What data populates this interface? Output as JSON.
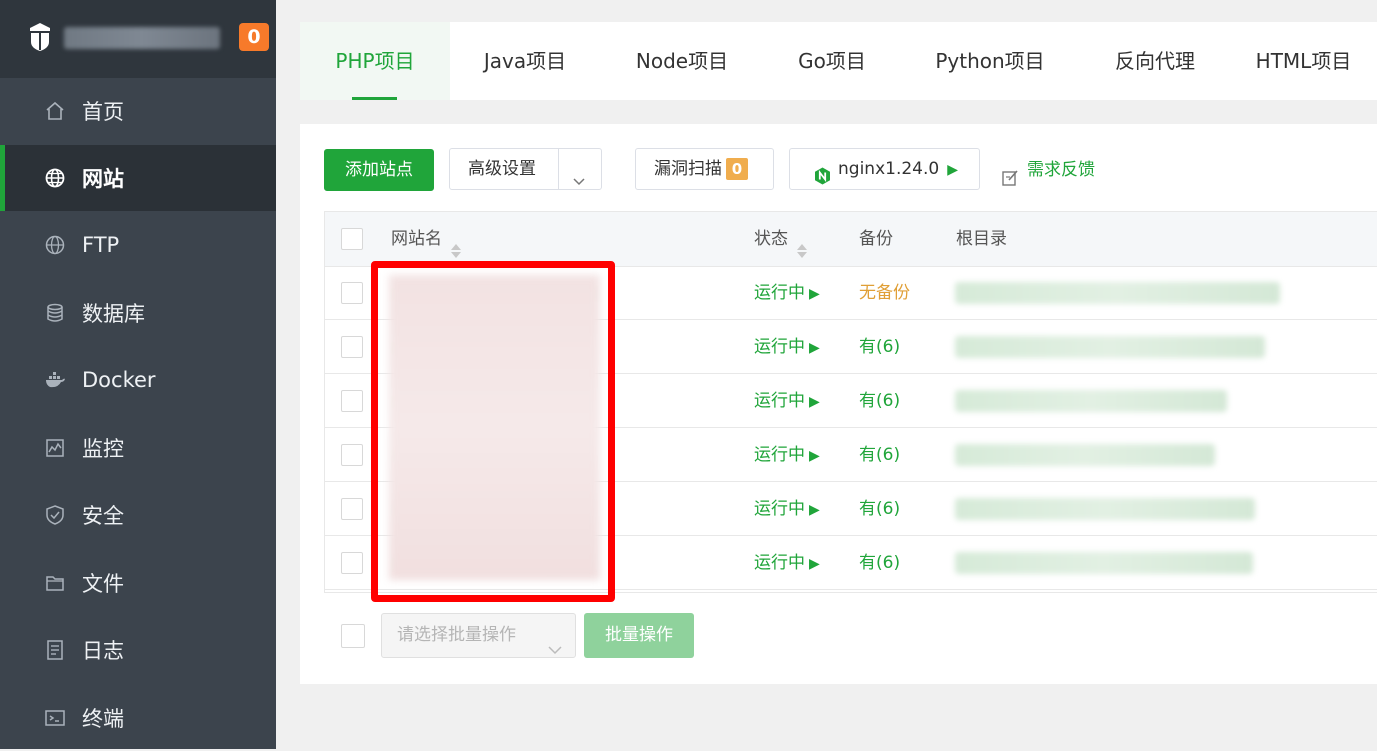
{
  "sidebar": {
    "server_badge": "0",
    "items": [
      {
        "label": "首页",
        "icon": "home-icon"
      },
      {
        "label": "网站",
        "icon": "globe-icon"
      },
      {
        "label": "FTP",
        "icon": "ftp-globe-icon"
      },
      {
        "label": "数据库",
        "icon": "database-icon"
      },
      {
        "label": "Docker",
        "icon": "docker-icon"
      },
      {
        "label": "监控",
        "icon": "monitor-icon"
      },
      {
        "label": "安全",
        "icon": "shield-icon"
      },
      {
        "label": "文件",
        "icon": "folder-icon"
      },
      {
        "label": "日志",
        "icon": "log-icon"
      },
      {
        "label": "终端",
        "icon": "terminal-icon"
      }
    ],
    "active_index": 1
  },
  "tabs": [
    "PHP项目",
    "Java项目",
    "Node项目",
    "Go项目",
    "Python项目",
    "反向代理",
    "HTML项目"
  ],
  "active_tab": 0,
  "toolbar": {
    "add_site": "添加站点",
    "advanced_settings": "高级设置",
    "vuln_scan": "漏洞扫描",
    "vuln_count": "0",
    "nginx": "nginx1.24.0",
    "feedback": "需求反馈"
  },
  "table": {
    "headers": {
      "name": "网站名",
      "status": "状态",
      "backup": "备份",
      "root": "根目录"
    },
    "rows": [
      {
        "status": "运行中",
        "backup": "无备份"
      },
      {
        "status": "运行中",
        "backup": "有(6)"
      },
      {
        "status": "运行中",
        "backup": "有(6)"
      },
      {
        "status": "运行中",
        "backup": "有(6)"
      },
      {
        "status": "运行中",
        "backup": "有(6)"
      },
      {
        "status": "运行中",
        "backup": "有(6)"
      }
    ]
  },
  "batch": {
    "placeholder": "请选择批量操作",
    "button": "批量操作"
  },
  "colors": {
    "accent_green": "#20a53a",
    "sidebar_bg": "#3c444d",
    "badge_orange": "#f77a2a",
    "highlight_red": "#ff0000",
    "no_backup_orange": "#e09f36"
  }
}
